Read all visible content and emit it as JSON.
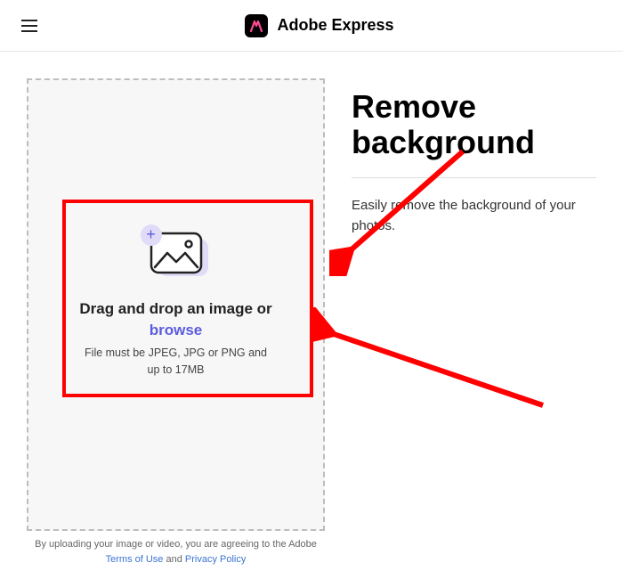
{
  "header": {
    "product_name": "Adobe Express"
  },
  "dropzone": {
    "title": "Drag and drop an image or",
    "browse_label": "browse",
    "hint": "File must be JPEG, JPG or PNG and up to 17MB"
  },
  "page": {
    "title": "Remove background",
    "subtitle": "Easily remove the background of your photos."
  },
  "legal": {
    "prefix": "By uploading your image or video, you are agreeing to the Adobe",
    "terms_label": "Terms of Use",
    "and": " and ",
    "privacy_label": "Privacy Policy"
  }
}
